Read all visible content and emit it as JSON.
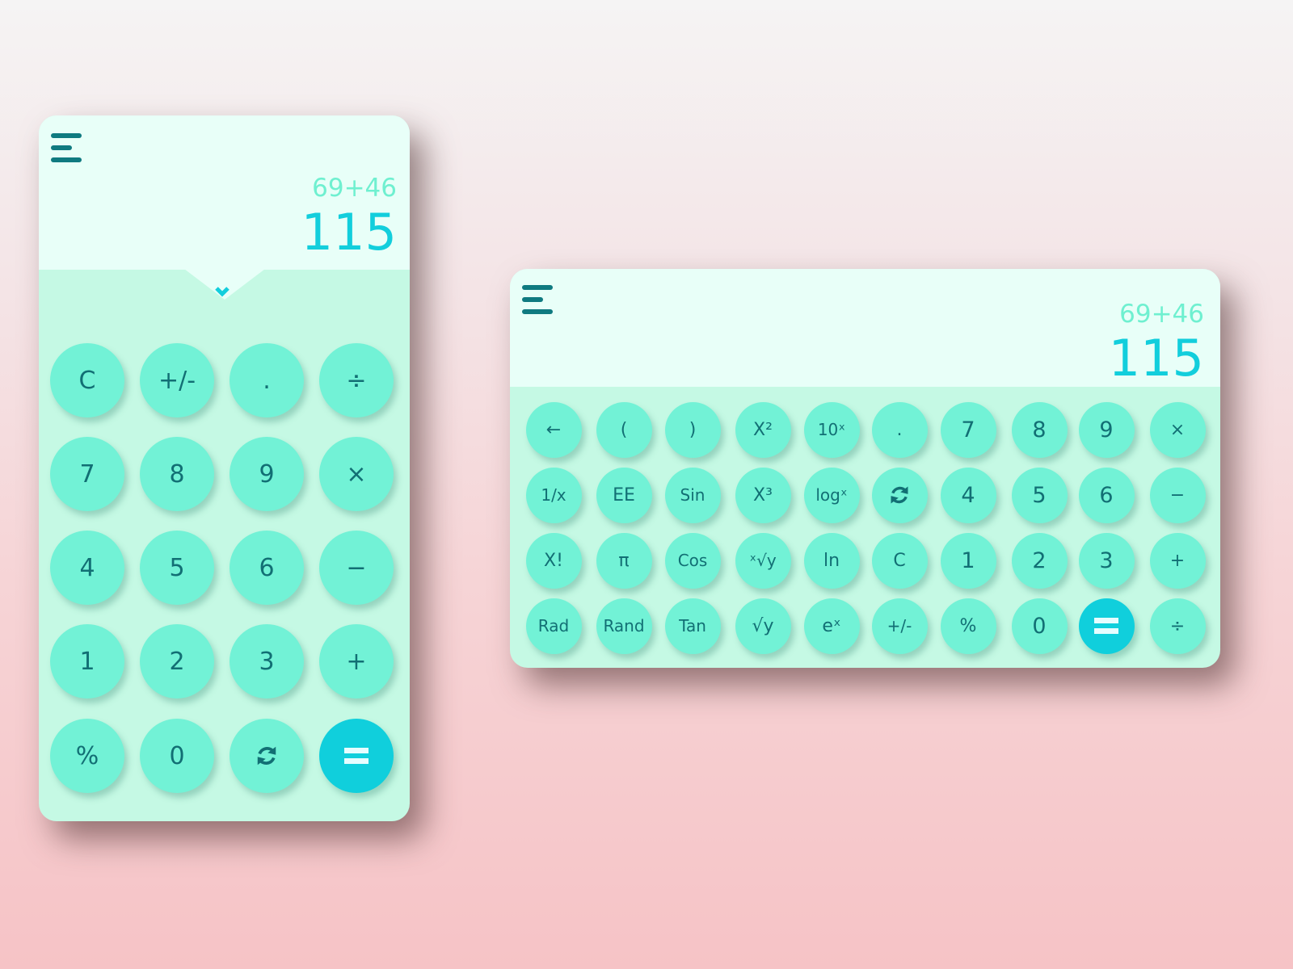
{
  "colors": {
    "display_bg": "#e8fff8",
    "keypad_bg": "#c5f9e4",
    "button_bg": "#72f2d6",
    "button_text": "#126f74",
    "accent": "#10cfdc",
    "expression_text": "#6ff0d0",
    "menu_icon": "#0f7a80"
  },
  "portrait": {
    "expression": "69+46",
    "result": "115",
    "menu_icon": "hamburger-menu-icon",
    "collapse_icon": "chevron-down-icon",
    "keys": [
      [
        "C",
        "+/-",
        ".",
        "÷"
      ],
      [
        "7",
        "8",
        "9",
        "×"
      ],
      [
        "4",
        "5",
        "6",
        "−"
      ],
      [
        "1",
        "2",
        "3",
        "+"
      ],
      [
        "%",
        "0",
        "refresh-icon",
        "="
      ]
    ]
  },
  "landscape": {
    "expression": "69+46",
    "result": "115",
    "menu_icon": "hamburger-menu-icon",
    "keys": [
      [
        "←",
        "(",
        ")",
        "X²",
        "10ˣ",
        ".",
        "7",
        "8",
        "9",
        "×"
      ],
      [
        "1/x",
        "EE",
        "Sin",
        "X³",
        "logˣ",
        "refresh-icon",
        "4",
        "5",
        "6",
        "−"
      ],
      [
        "X!",
        "π",
        "Cos",
        "ˣ√y",
        "ln",
        "C",
        "1",
        "2",
        "3",
        "+"
      ],
      [
        "Rad",
        "Rand",
        "Tan",
        "√y",
        "eˣ",
        "+/-",
        "%",
        "0",
        "=",
        "÷"
      ]
    ]
  }
}
